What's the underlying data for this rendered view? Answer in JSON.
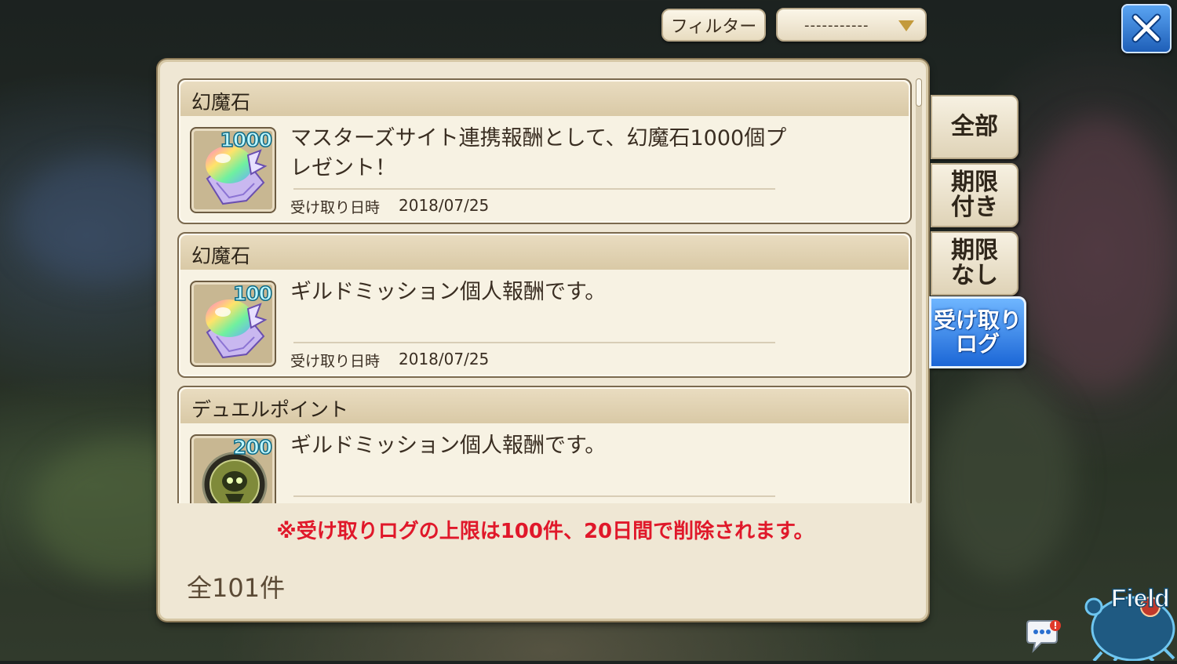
{
  "toolbar": {
    "filter_label": "フィルター",
    "filter_value": "-----------",
    "close_icon": "close-x-icon"
  },
  "entries": [
    {
      "title": "幻魔石",
      "icon": "magic-stone-icon",
      "quantity": "1000",
      "description": "マスターズサイト連携報酬として、幻魔石1000個プレゼント！",
      "date_label": "受け取り日時",
      "date": "2018/07/25"
    },
    {
      "title": "幻魔石",
      "icon": "magic-stone-icon",
      "quantity": "100",
      "description": "ギルドミッション個人報酬です。",
      "date_label": "受け取り日時",
      "date": "2018/07/25"
    },
    {
      "title": "デュエルポイント",
      "icon": "duel-point-medal-icon",
      "quantity": "200",
      "description": "ギルドミッション個人報酬です。",
      "date_label": "受け取り日時",
      "date": ""
    }
  ],
  "notice": "※受け取りログの上限は100件、20日間で削除されます。",
  "total": "全101件",
  "tabs": [
    {
      "label": "全部",
      "active": false
    },
    {
      "label": "期限\n付き",
      "active": false
    },
    {
      "label": "期限\nなし",
      "active": false
    },
    {
      "label": "受け取り\nログ",
      "active": true
    }
  ],
  "corner": {
    "field_label": "Field",
    "chat_icon": "chat-bubble-icon"
  },
  "colors": {
    "notice": "#e0182a",
    "active_tab": "#1b66d6",
    "quantity_text": "#bff7ff"
  }
}
